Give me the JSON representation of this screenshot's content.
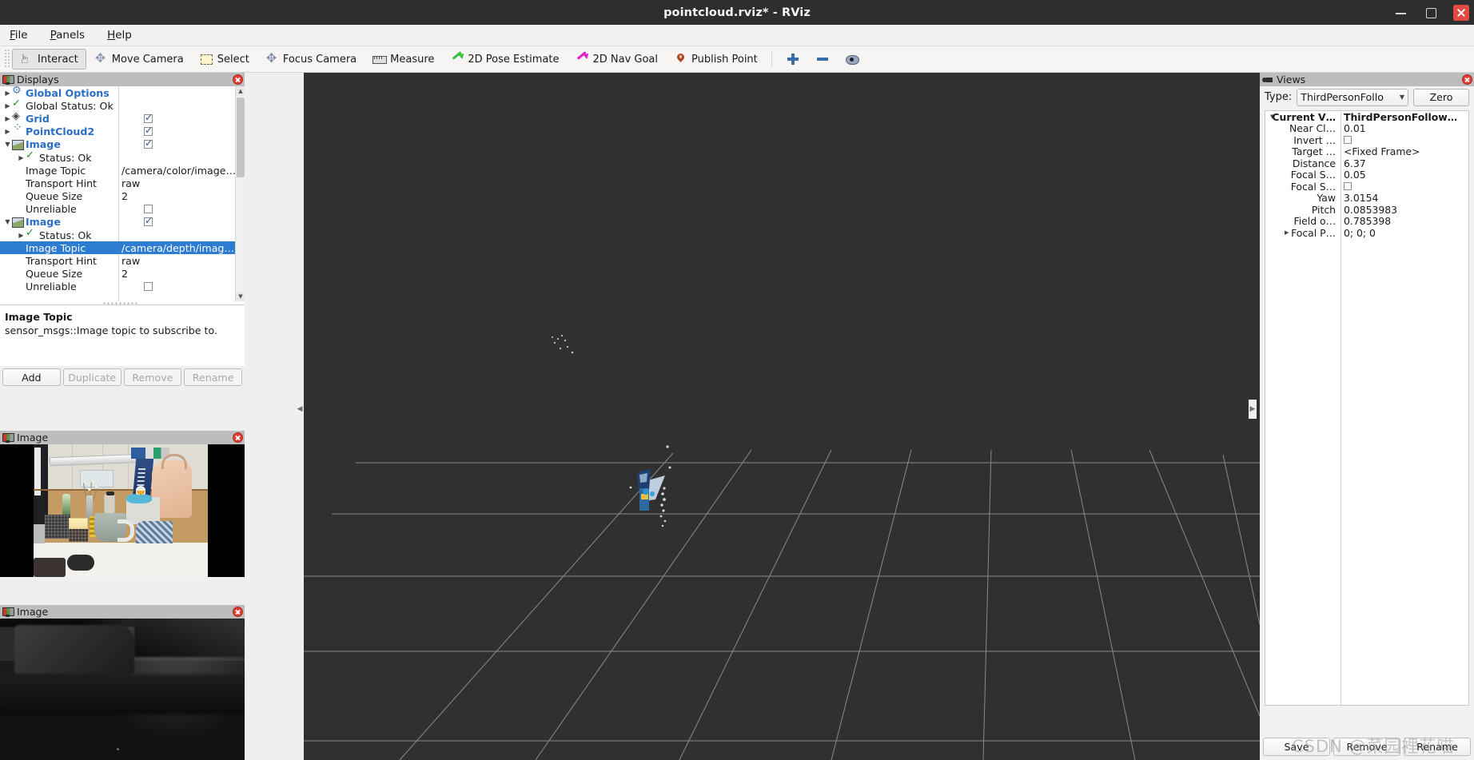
{
  "window": {
    "title": "pointcloud.rviz* - RViz",
    "minimize": "minimize",
    "maximize": "maximize",
    "close": "close"
  },
  "menu": [
    {
      "label": "File"
    },
    {
      "label": "Panels"
    },
    {
      "label": "Help"
    }
  ],
  "toolbar": {
    "buttons": [
      {
        "label": "Interact",
        "icon": "hand-icon",
        "active": true
      },
      {
        "label": "Move Camera",
        "icon": "move-camera-icon",
        "active": false
      },
      {
        "label": "Select",
        "icon": "select-icon",
        "active": false
      },
      {
        "label": "Focus Camera",
        "icon": "focus-camera-icon",
        "active": false
      },
      {
        "label": "Measure",
        "icon": "ruler-icon",
        "active": false
      },
      {
        "label": "2D Pose Estimate",
        "icon": "green-arrow-icon",
        "active": false
      },
      {
        "label": "2D Nav Goal",
        "icon": "magenta-arrow-icon",
        "active": false
      },
      {
        "label": "Publish Point",
        "icon": "map-pin-icon",
        "active": false
      }
    ],
    "extra_icons": [
      {
        "name": "zoom-in-icon"
      },
      {
        "name": "zoom-out-icon"
      },
      {
        "name": "eye-icon"
      }
    ]
  },
  "displays": {
    "title": "Displays",
    "icon": "displays-icon",
    "close_icon": "close-icon",
    "rows": [
      {
        "indent": 0,
        "twisty": "right",
        "icon": "gear-icon",
        "label": "Global Options",
        "bold": true,
        "value": "",
        "check": null,
        "selected": false
      },
      {
        "indent": 0,
        "twisty": "right",
        "icon": "check-icon",
        "label": "Global Status: Ok",
        "bold": false,
        "value": "",
        "check": null,
        "selected": false
      },
      {
        "indent": 0,
        "twisty": "right",
        "icon": "grid-icon",
        "label": "Grid",
        "bold": true,
        "value": "",
        "check": true,
        "selected": false
      },
      {
        "indent": 0,
        "twisty": "right",
        "icon": "pointcloud-icon",
        "label": "PointCloud2",
        "bold": true,
        "value": "",
        "check": true,
        "selected": false
      },
      {
        "indent": 0,
        "twisty": "down",
        "icon": "image-icon",
        "label": "Image",
        "bold": true,
        "value": "",
        "check": true,
        "selected": false
      },
      {
        "indent": 1,
        "twisty": "right",
        "icon": "check-icon",
        "label": "Status: Ok",
        "bold": false,
        "value": "",
        "check": null,
        "selected": false
      },
      {
        "indent": 1,
        "twisty": "none",
        "icon": "none",
        "label": "Image Topic",
        "bold": false,
        "value": "/camera/color/image…",
        "check": null,
        "selected": false
      },
      {
        "indent": 1,
        "twisty": "none",
        "icon": "none",
        "label": "Transport Hint",
        "bold": false,
        "value": "raw",
        "check": null,
        "selected": false
      },
      {
        "indent": 1,
        "twisty": "none",
        "icon": "none",
        "label": "Queue Size",
        "bold": false,
        "value": "2",
        "check": null,
        "selected": false
      },
      {
        "indent": 1,
        "twisty": "none",
        "icon": "none",
        "label": "Unreliable",
        "bold": false,
        "value": "",
        "check": false,
        "selected": false
      },
      {
        "indent": 0,
        "twisty": "down",
        "icon": "image-icon",
        "label": "Image",
        "bold": true,
        "value": "",
        "check": true,
        "selected": false
      },
      {
        "indent": 1,
        "twisty": "right",
        "icon": "check-icon",
        "label": "Status: Ok",
        "bold": false,
        "value": "",
        "check": null,
        "selected": false
      },
      {
        "indent": 1,
        "twisty": "none",
        "icon": "none",
        "label": "Image Topic",
        "bold": false,
        "value": "/camera/depth/imag…",
        "check": null,
        "selected": true
      },
      {
        "indent": 1,
        "twisty": "none",
        "icon": "none",
        "label": "Transport Hint",
        "bold": false,
        "value": "raw",
        "check": null,
        "selected": false
      },
      {
        "indent": 1,
        "twisty": "none",
        "icon": "none",
        "label": "Queue Size",
        "bold": false,
        "value": "2",
        "check": null,
        "selected": false
      },
      {
        "indent": 1,
        "twisty": "none",
        "icon": "none",
        "label": "Unreliable",
        "bold": false,
        "value": "",
        "check": false,
        "selected": false
      }
    ],
    "description": {
      "title": "Image Topic",
      "body": "sensor_msgs::Image topic to subscribe to."
    },
    "buttons": [
      {
        "label": "Add",
        "enabled": true
      },
      {
        "label": "Duplicate",
        "enabled": false
      },
      {
        "label": "Remove",
        "enabled": false
      },
      {
        "label": "Rename",
        "enabled": false
      }
    ]
  },
  "image_panels": [
    {
      "title": "Image",
      "icon": "image-icon",
      "close_icon": "close-icon",
      "kind": "color"
    },
    {
      "title": "Image",
      "icon": "image-icon",
      "close_icon": "close-icon",
      "kind": "depth"
    }
  ],
  "views": {
    "title": "Views",
    "icon": "views-icon",
    "close_icon": "close-icon",
    "type_label": "Type:",
    "type_value": "ThirdPersonFollo",
    "zero_label": "Zero",
    "rows": [
      {
        "indent": 0,
        "twisty": "down",
        "key": "Current V…",
        "value": "ThirdPersonFollow…",
        "bold": true,
        "check": null
      },
      {
        "indent": 1,
        "twisty": "none",
        "key": "Near Cl…",
        "value": "0.01",
        "bold": false,
        "check": null
      },
      {
        "indent": 1,
        "twisty": "none",
        "key": "Invert …",
        "value": "",
        "bold": false,
        "check": false
      },
      {
        "indent": 1,
        "twisty": "none",
        "key": "Target …",
        "value": "<Fixed Frame>",
        "bold": false,
        "check": null
      },
      {
        "indent": 1,
        "twisty": "none",
        "key": "Distance",
        "value": "6.37",
        "bold": false,
        "check": null
      },
      {
        "indent": 1,
        "twisty": "none",
        "key": "Focal S…",
        "value": "0.05",
        "bold": false,
        "check": null
      },
      {
        "indent": 1,
        "twisty": "none",
        "key": "Focal S…",
        "value": "",
        "bold": false,
        "check": false
      },
      {
        "indent": 1,
        "twisty": "none",
        "key": "Yaw",
        "value": "3.0154",
        "bold": false,
        "check": null
      },
      {
        "indent": 1,
        "twisty": "none",
        "key": "Pitch",
        "value": "0.0853983",
        "bold": false,
        "check": null
      },
      {
        "indent": 1,
        "twisty": "none",
        "key": "Field o…",
        "value": "0.785398",
        "bold": false,
        "check": null
      },
      {
        "indent": 1,
        "twisty": "right",
        "key": "Focal P…",
        "value": "0; 0; 0",
        "bold": false,
        "check": null
      }
    ],
    "buttons": [
      {
        "label": "Save"
      },
      {
        "label": "Remove"
      },
      {
        "label": "Rename"
      }
    ]
  },
  "viewport": {
    "background_color": "#303030",
    "grid_color": "#9a9a9a",
    "watermark": "CSDN @菜园裡花喵"
  }
}
